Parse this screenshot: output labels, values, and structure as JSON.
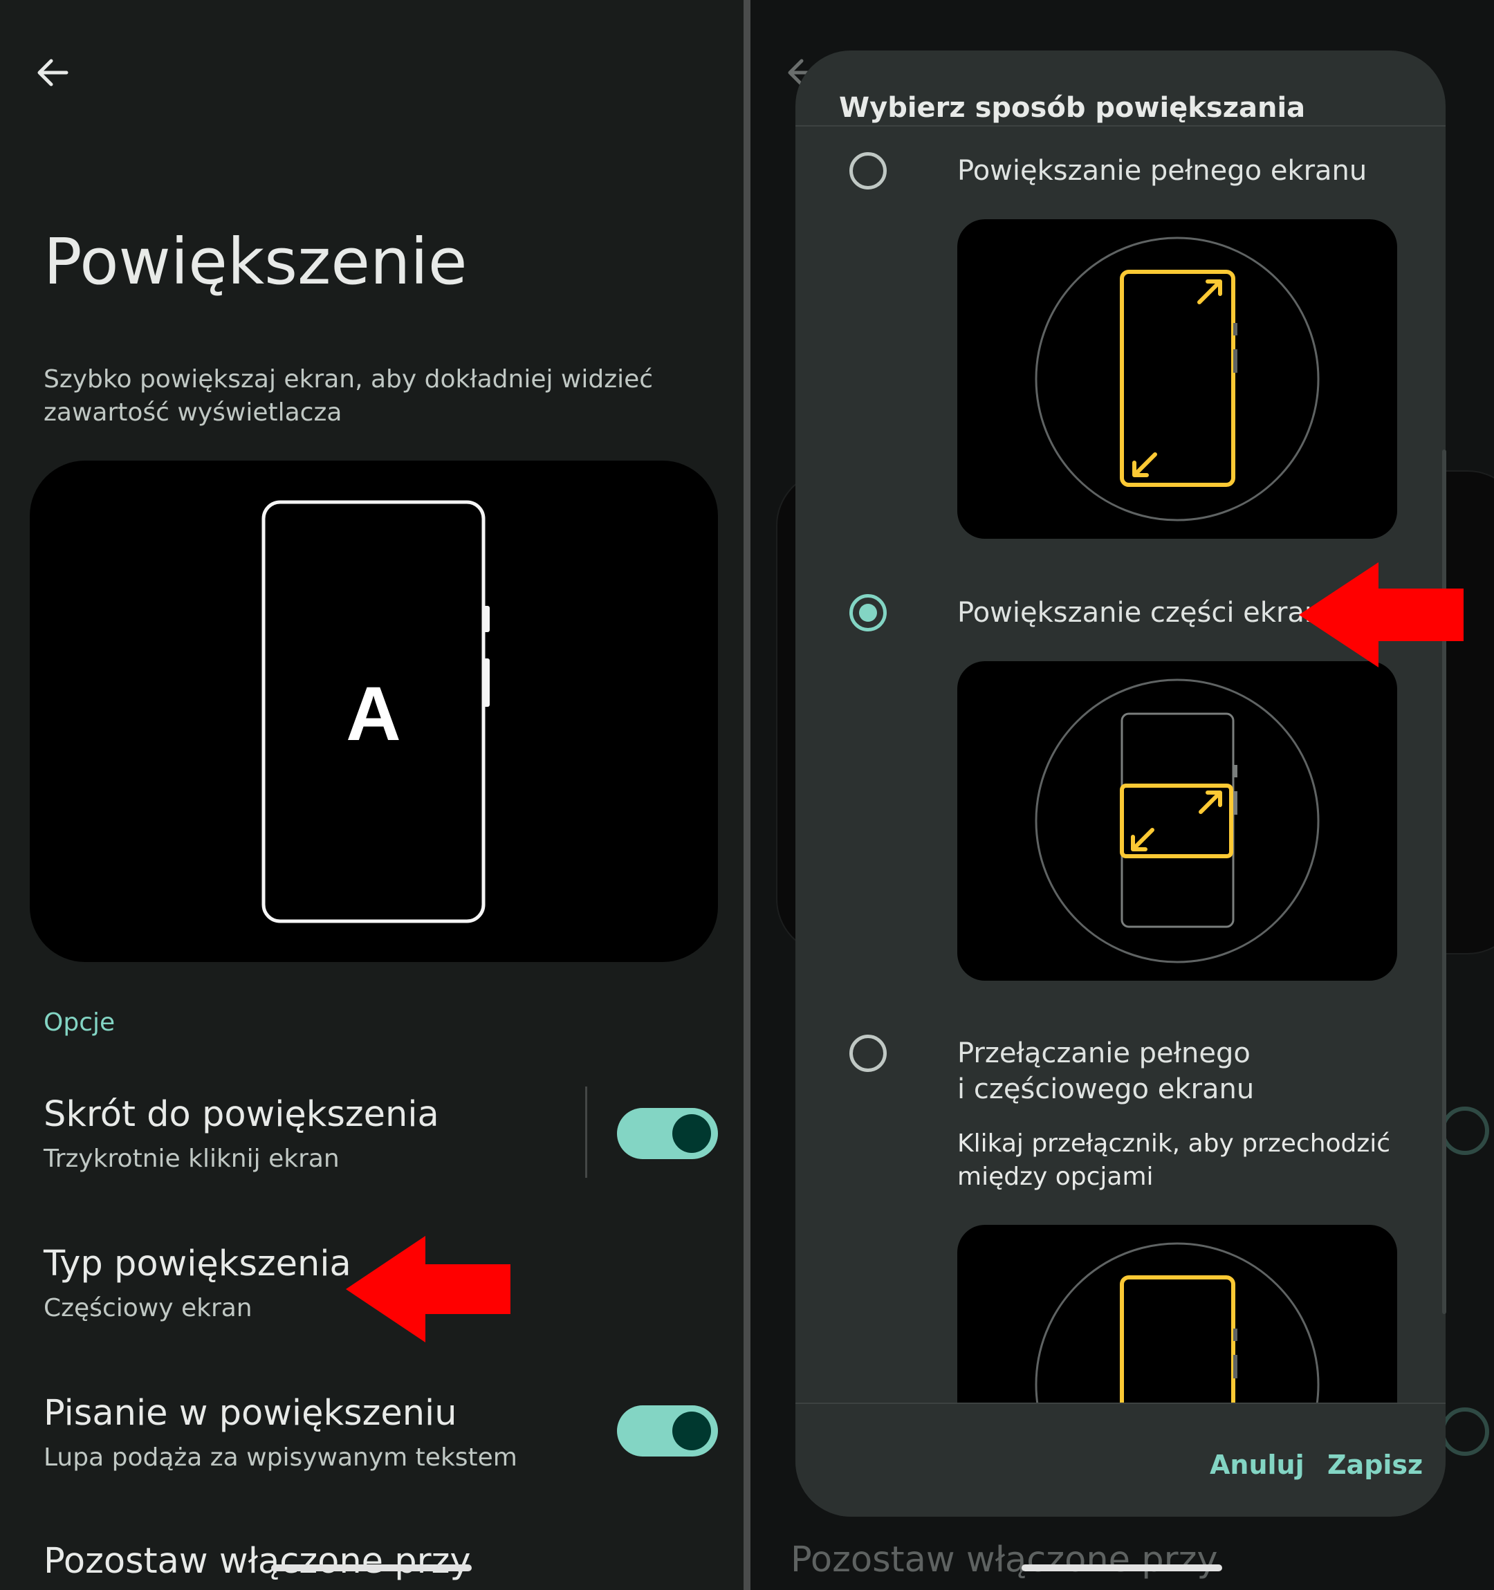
{
  "left": {
    "title": "Powiększenie",
    "description": "Szybko powiększaj ekran, aby dokładniej widzieć zawartość wyświetlacza",
    "preview_letter": "A",
    "section_label": "Opcje",
    "items": [
      {
        "title": "Skrót do powiększenia",
        "subtitle": "Trzykrotnie kliknij ekran",
        "toggle": true
      },
      {
        "title": "Typ powiększenia",
        "subtitle": "Częściowy ekran"
      },
      {
        "title": "Pisanie w powiększeniu",
        "subtitle": "Lupa podąża za wpisywanym tekstem",
        "toggle": true
      },
      {
        "title": "Pozostaw włączone przy"
      }
    ]
  },
  "dialog": {
    "title": "Wybierz sposób powiększania",
    "options": [
      {
        "label": "Powiększanie pełnego ekranu",
        "selected": false
      },
      {
        "label": "Powiększanie części ekranu",
        "selected": true
      },
      {
        "label_line1": "Przełączanie pełnego",
        "label_line2": "i częściowego ekranu",
        "description": "Klikaj przełącznik, aby przechodzić między opcjami",
        "selected": false
      }
    ],
    "cancel": "Anuluj",
    "save": "Zapisz"
  },
  "right_bg": {
    "bottom_item": "Pozostaw włączone przy"
  },
  "colors": {
    "accent": "#83d5c4",
    "highlight": "#fcc934",
    "arrow": "#ff0000",
    "background": "#191c1b",
    "dialog": "#2c3130"
  }
}
